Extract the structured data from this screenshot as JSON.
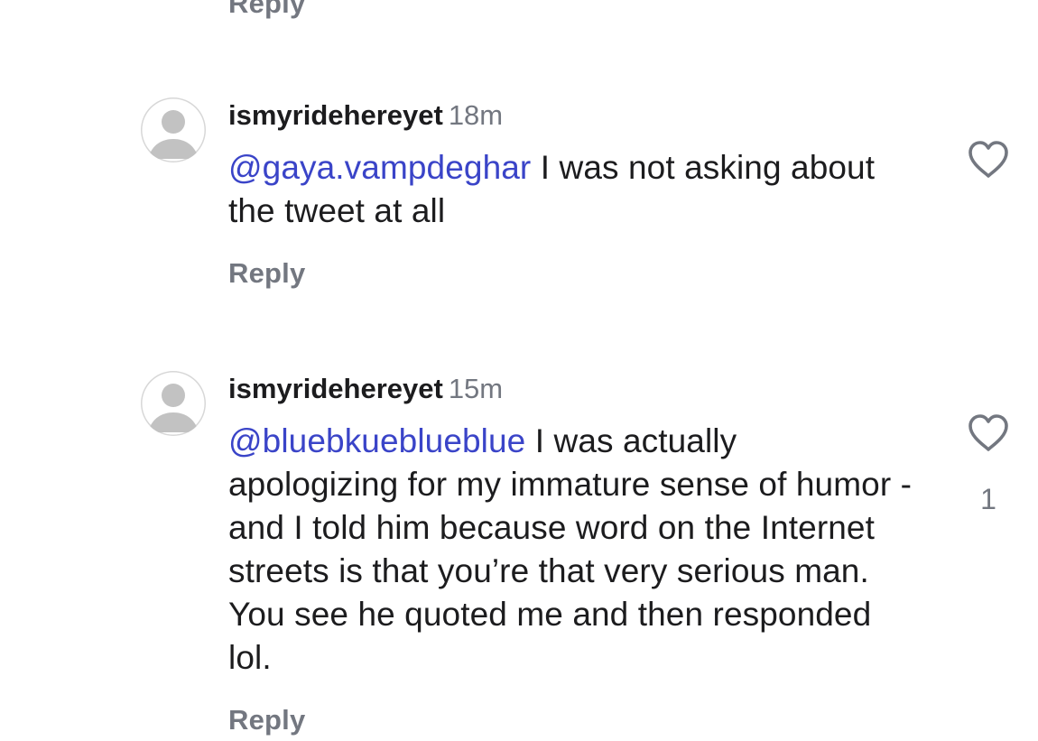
{
  "top_reply_label": "Reply",
  "comments": [
    {
      "username": "ismyridehereyet",
      "time": "18m",
      "mention": "@gaya.vampdeghar",
      "text": " I was not asking about the tweet at all",
      "reply_label": "Reply",
      "like_count": ""
    },
    {
      "username": "ismyridehereyet",
      "time": "15m",
      "mention": "@bluebkueblueblue",
      "text": " I was actually apologizing for my immature sense of humor - and I told him because word on the Internet streets is that you’re that very serious man.  You see he quoted me and then responded lol.",
      "reply_label": "Reply",
      "like_count": "1"
    }
  ],
  "colors": {
    "mention": "#3a44c8",
    "secondary_text": "#737780",
    "primary_text": "#1c1c1e",
    "avatar_silhouette": "#c2c2c2"
  },
  "icons": {
    "avatar": "default-avatar-icon",
    "like": "heart-outline-icon"
  }
}
